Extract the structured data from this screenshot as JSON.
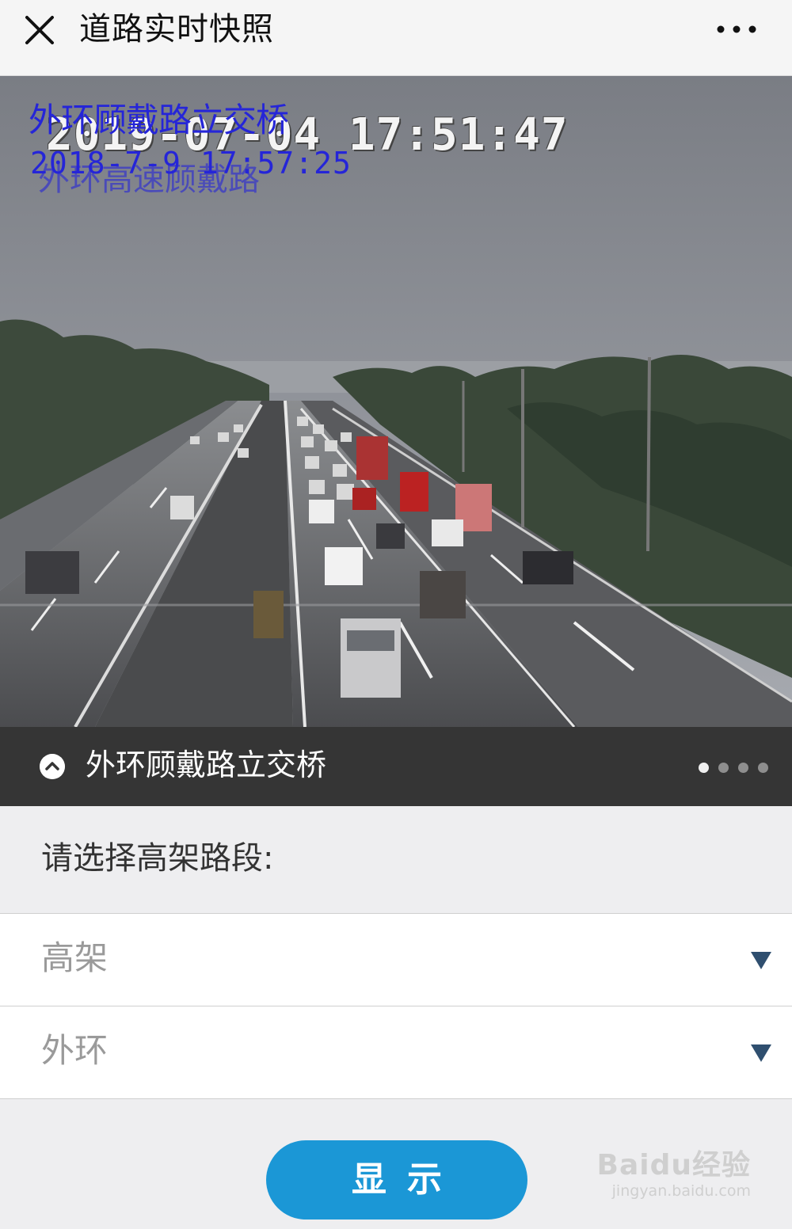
{
  "header": {
    "title": "道路实时快照",
    "close_icon": "close-icon",
    "more_icon": "more-icon"
  },
  "snapshot": {
    "osd_location": "外环顾戴路立交桥",
    "osd_timestamp": "2019-07-04 17:51:47",
    "osd_timestamp_overlay": "2018-7-9 17:57:25",
    "osd_location_overlay": "外环高速顾戴路"
  },
  "caption": {
    "label": "外环顾戴路立交桥",
    "toggle_icon": "chevron-up-icon",
    "page_count": 4,
    "active_page": 1
  },
  "form": {
    "prompt": "请选择高架路段:",
    "selects": [
      {
        "value": "高架",
        "icon": "dropdown-arrow-icon"
      },
      {
        "value": "外环",
        "icon": "dropdown-arrow-icon"
      }
    ],
    "submit_label": "显示"
  },
  "watermark": {
    "logo": "Baidu经验",
    "url": "jingyan.baidu.com"
  },
  "colors": {
    "accent": "#1b97d6",
    "caption_bg": "#353535",
    "page_bg": "#eeeef0",
    "osd_text": "#2525d8"
  }
}
